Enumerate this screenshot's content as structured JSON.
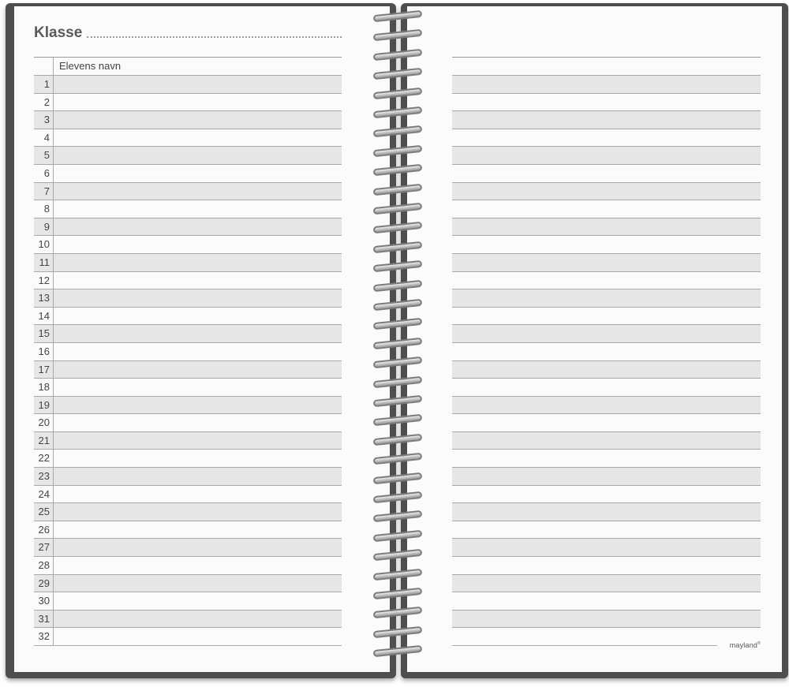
{
  "left_page": {
    "title": "Klasse",
    "column_header": "Elevens navn",
    "rows": [
      "1",
      "2",
      "3",
      "4",
      "5",
      "6",
      "7",
      "8",
      "9",
      "10",
      "11",
      "12",
      "13",
      "14",
      "15",
      "16",
      "17",
      "18",
      "19",
      "20",
      "21",
      "22",
      "23",
      "24",
      "25",
      "26",
      "27",
      "28",
      "29",
      "30",
      "31",
      "32"
    ]
  },
  "right_page": {
    "brand": "mayland"
  },
  "colors": {
    "cover": "#4e4e4e",
    "page": "#fbfbfb",
    "row_shade": "#e6e6e6"
  }
}
